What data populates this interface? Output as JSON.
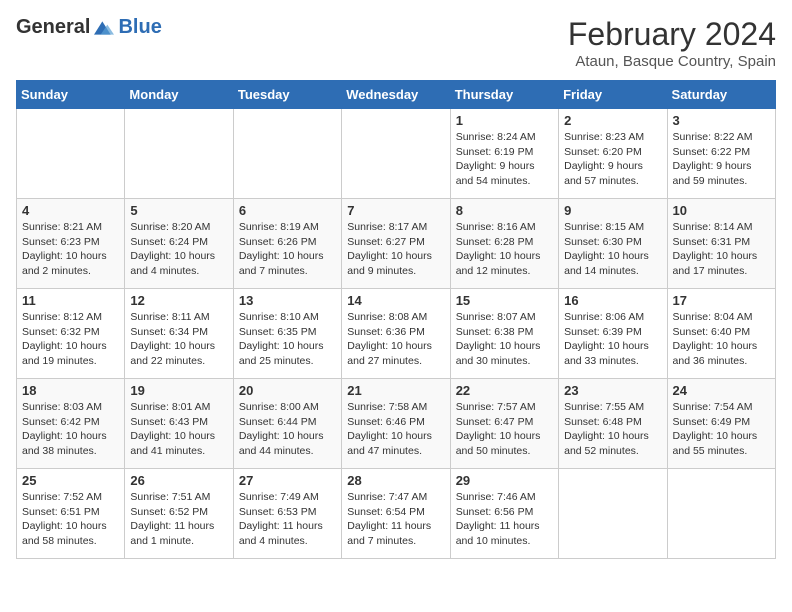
{
  "header": {
    "logo_general": "General",
    "logo_blue": "Blue",
    "month_title": "February 2024",
    "location": "Ataun, Basque Country, Spain"
  },
  "days_of_week": [
    "Sunday",
    "Monday",
    "Tuesday",
    "Wednesday",
    "Thursday",
    "Friday",
    "Saturday"
  ],
  "weeks": [
    [
      {
        "day": "",
        "info": ""
      },
      {
        "day": "",
        "info": ""
      },
      {
        "day": "",
        "info": ""
      },
      {
        "day": "",
        "info": ""
      },
      {
        "day": "1",
        "info": "Sunrise: 8:24 AM\nSunset: 6:19 PM\nDaylight: 9 hours\nand 54 minutes."
      },
      {
        "day": "2",
        "info": "Sunrise: 8:23 AM\nSunset: 6:20 PM\nDaylight: 9 hours\nand 57 minutes."
      },
      {
        "day": "3",
        "info": "Sunrise: 8:22 AM\nSunset: 6:22 PM\nDaylight: 9 hours\nand 59 minutes."
      }
    ],
    [
      {
        "day": "4",
        "info": "Sunrise: 8:21 AM\nSunset: 6:23 PM\nDaylight: 10 hours\nand 2 minutes."
      },
      {
        "day": "5",
        "info": "Sunrise: 8:20 AM\nSunset: 6:24 PM\nDaylight: 10 hours\nand 4 minutes."
      },
      {
        "day": "6",
        "info": "Sunrise: 8:19 AM\nSunset: 6:26 PM\nDaylight: 10 hours\nand 7 minutes."
      },
      {
        "day": "7",
        "info": "Sunrise: 8:17 AM\nSunset: 6:27 PM\nDaylight: 10 hours\nand 9 minutes."
      },
      {
        "day": "8",
        "info": "Sunrise: 8:16 AM\nSunset: 6:28 PM\nDaylight: 10 hours\nand 12 minutes."
      },
      {
        "day": "9",
        "info": "Sunrise: 8:15 AM\nSunset: 6:30 PM\nDaylight: 10 hours\nand 14 minutes."
      },
      {
        "day": "10",
        "info": "Sunrise: 8:14 AM\nSunset: 6:31 PM\nDaylight: 10 hours\nand 17 minutes."
      }
    ],
    [
      {
        "day": "11",
        "info": "Sunrise: 8:12 AM\nSunset: 6:32 PM\nDaylight: 10 hours\nand 19 minutes."
      },
      {
        "day": "12",
        "info": "Sunrise: 8:11 AM\nSunset: 6:34 PM\nDaylight: 10 hours\nand 22 minutes."
      },
      {
        "day": "13",
        "info": "Sunrise: 8:10 AM\nSunset: 6:35 PM\nDaylight: 10 hours\nand 25 minutes."
      },
      {
        "day": "14",
        "info": "Sunrise: 8:08 AM\nSunset: 6:36 PM\nDaylight: 10 hours\nand 27 minutes."
      },
      {
        "day": "15",
        "info": "Sunrise: 8:07 AM\nSunset: 6:38 PM\nDaylight: 10 hours\nand 30 minutes."
      },
      {
        "day": "16",
        "info": "Sunrise: 8:06 AM\nSunset: 6:39 PM\nDaylight: 10 hours\nand 33 minutes."
      },
      {
        "day": "17",
        "info": "Sunrise: 8:04 AM\nSunset: 6:40 PM\nDaylight: 10 hours\nand 36 minutes."
      }
    ],
    [
      {
        "day": "18",
        "info": "Sunrise: 8:03 AM\nSunset: 6:42 PM\nDaylight: 10 hours\nand 38 minutes."
      },
      {
        "day": "19",
        "info": "Sunrise: 8:01 AM\nSunset: 6:43 PM\nDaylight: 10 hours\nand 41 minutes."
      },
      {
        "day": "20",
        "info": "Sunrise: 8:00 AM\nSunset: 6:44 PM\nDaylight: 10 hours\nand 44 minutes."
      },
      {
        "day": "21",
        "info": "Sunrise: 7:58 AM\nSunset: 6:46 PM\nDaylight: 10 hours\nand 47 minutes."
      },
      {
        "day": "22",
        "info": "Sunrise: 7:57 AM\nSunset: 6:47 PM\nDaylight: 10 hours\nand 50 minutes."
      },
      {
        "day": "23",
        "info": "Sunrise: 7:55 AM\nSunset: 6:48 PM\nDaylight: 10 hours\nand 52 minutes."
      },
      {
        "day": "24",
        "info": "Sunrise: 7:54 AM\nSunset: 6:49 PM\nDaylight: 10 hours\nand 55 minutes."
      }
    ],
    [
      {
        "day": "25",
        "info": "Sunrise: 7:52 AM\nSunset: 6:51 PM\nDaylight: 10 hours\nand 58 minutes."
      },
      {
        "day": "26",
        "info": "Sunrise: 7:51 AM\nSunset: 6:52 PM\nDaylight: 11 hours\nand 1 minute."
      },
      {
        "day": "27",
        "info": "Sunrise: 7:49 AM\nSunset: 6:53 PM\nDaylight: 11 hours\nand 4 minutes."
      },
      {
        "day": "28",
        "info": "Sunrise: 7:47 AM\nSunset: 6:54 PM\nDaylight: 11 hours\nand 7 minutes."
      },
      {
        "day": "29",
        "info": "Sunrise: 7:46 AM\nSunset: 6:56 PM\nDaylight: 11 hours\nand 10 minutes."
      },
      {
        "day": "",
        "info": ""
      },
      {
        "day": "",
        "info": ""
      }
    ]
  ]
}
